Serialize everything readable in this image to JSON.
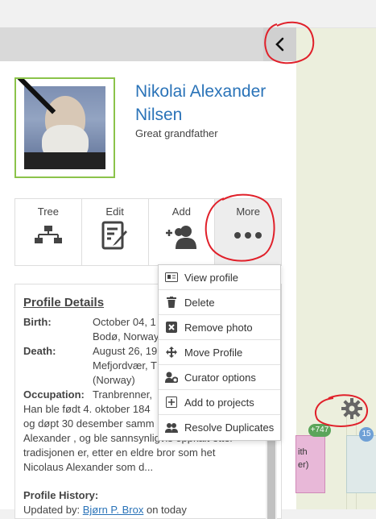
{
  "profile": {
    "name": "Nikolai Alexander Nilsen",
    "relation": "Great grandfather"
  },
  "actions": [
    {
      "label": "Tree",
      "icon": "tree-icon"
    },
    {
      "label": "Edit",
      "icon": "edit-icon"
    },
    {
      "label": "Add",
      "icon": "add-person-icon"
    },
    {
      "label": "More",
      "icon": "more-icon"
    }
  ],
  "details": {
    "title": "Profile Details",
    "birth_label": "Birth:",
    "birth_value_1": "October 04, 1",
    "birth_value_2": "Bodø, Norway",
    "death_label": "Death:",
    "death_value_1": "August 26, 19",
    "death_value_2": "Mefjordvær, T",
    "death_value_3": "(Norway)",
    "occupation_label": "Occupation:",
    "occupation_value": "Tranbrenner,",
    "bio_1": "Han ble født 4. oktober 184",
    "bio_2": "og døpt 30 desember samm",
    "bio_3": "Alexander , og ble sannsynligvis oppkalt etter",
    "bio_4": "tradisjonen er, etter en eldre bror som het",
    "bio_5": "Nicolaus Alexander som d...",
    "history_title": "Profile History:",
    "history_prefix": "Updated by:",
    "history_user": "Bjørn P. Brox",
    "history_suffix": "on today"
  },
  "more_menu": [
    {
      "label": "View profile",
      "icon": "id-card-icon"
    },
    {
      "label": "Delete",
      "icon": "trash-icon"
    },
    {
      "label": "Remove photo",
      "icon": "remove-photo-icon"
    },
    {
      "label": "Move Profile",
      "icon": "move-icon"
    },
    {
      "label": "Curator options",
      "icon": "curator-icon"
    },
    {
      "label": "Add to projects",
      "icon": "plus-square-icon"
    },
    {
      "label": "Resolve Duplicates",
      "icon": "duplicates-icon"
    }
  ],
  "map": {
    "badge_count": "+747",
    "node_text_1": "ith",
    "node_text_2": "er)",
    "badge2": "15"
  },
  "colors": {
    "link": "#2a73b8",
    "photo_border": "#8bc34a",
    "annotation": "#e0202a"
  }
}
